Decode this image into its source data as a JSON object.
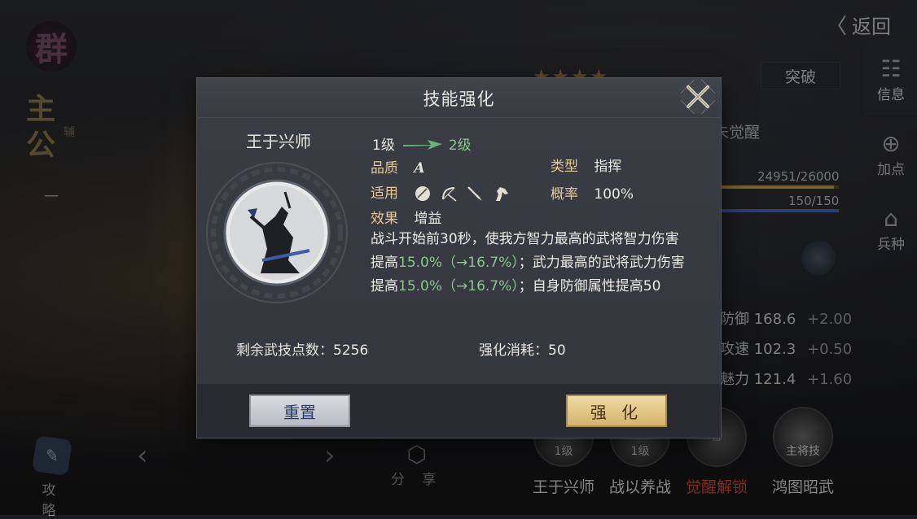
{
  "colors": {
    "accent_gold": "#e0c99a",
    "increase_green": "#8cc58f",
    "locked_red": "#c94a3b",
    "modal_bg": "#383b41",
    "reset_button": "#c9ced5",
    "upgrade_button": "#e2c88a"
  },
  "background": {
    "seal_char": "群",
    "lord_title": "主公",
    "lord_sub": "辅",
    "lord_num": "一",
    "back_label": "返回",
    "stars": "★★★★",
    "breakthrough_label": "突破",
    "awaken_status": "未觉醒",
    "xp_text": "24951/26000",
    "xp_ratio": 0.96,
    "troops_text": "150/150",
    "troops_ratio": 1.0,
    "stats": [
      {
        "label": "防御",
        "value": "168.6",
        "bonus": "+2.00"
      },
      {
        "label": "攻速",
        "value": "102.3",
        "bonus": "+0.50"
      },
      {
        "label": "魅力",
        "value": "121.4",
        "bonus": "+1.60"
      }
    ],
    "side_tabs": [
      {
        "label": "信息",
        "icon": "scroll-icon",
        "active": true
      },
      {
        "label": "加点",
        "icon": "add-points-icon",
        "active": false
      },
      {
        "label": "兵种",
        "icon": "helmet-icon",
        "active": false
      }
    ],
    "strategy_label": "攻 略",
    "share_label": "分 享",
    "skill_slots": [
      {
        "name": "王于兴师",
        "level": "1级"
      },
      {
        "name": "战以养战",
        "level": "1级"
      },
      {
        "name": "觉醒解锁",
        "level": ""
      },
      {
        "name": "鸿图昭武",
        "level": "主将技"
      }
    ]
  },
  "modal": {
    "title": "技能强化",
    "skill_name": "王于兴师",
    "level_from": "1级",
    "level_to": "2级",
    "quality_label": "品质",
    "quality_value": "A",
    "type_label": "类型",
    "type_value": "指挥",
    "apply_label": "适用",
    "apply_icons": [
      "shield-icon",
      "bow-icon",
      "spear-icon",
      "horse-icon"
    ],
    "chance_label": "概率",
    "chance_value": "100%",
    "effect_label": "效果",
    "effect_value": "增益",
    "description": {
      "p1": "战斗开始前30秒，使我方智力最高的武将智力伤害提高",
      "g1": "15.0%（→16.7%）",
      "p2": "；武力最高的武将武力伤害提高",
      "g2": "15.0%（→16.7%）",
      "p3": "；自身防御属性提高50"
    },
    "points_label": "剩余武技点数：",
    "points_value": "5256",
    "cost_label": "强化消耗：",
    "cost_value": "50",
    "reset_label": "重置",
    "upgrade_label": "强 化"
  }
}
